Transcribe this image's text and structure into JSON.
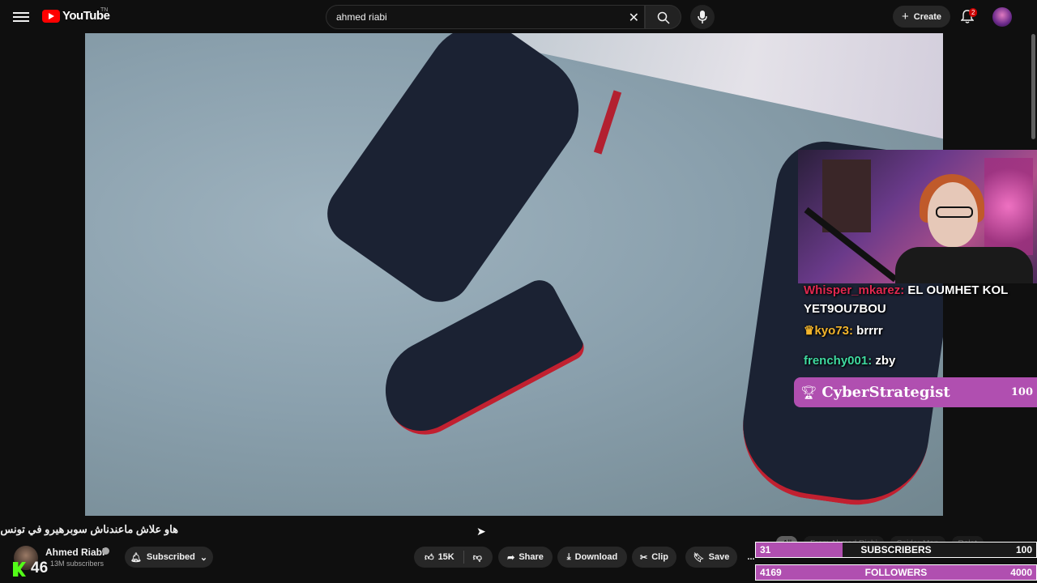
{
  "header": {
    "logo_text": "YouTube",
    "country_code": "TN",
    "search_value": "ahmed riabi",
    "create_label": "Create",
    "notification_count": "2"
  },
  "video": {
    "title": "هاو علاش ماعندناش سوبرهيرو في تونس"
  },
  "channel": {
    "name": "Ahmed Riabi",
    "subscribers": "13M subscribers",
    "subscribe_label": "Subscribed"
  },
  "actions": {
    "likes": "15K",
    "share": "Share",
    "download": "Download",
    "clip": "Clip",
    "save": "Save",
    "more": "..."
  },
  "chips": [
    "All",
    "From Ahmed Riabi",
    "Spider-Man",
    "Relat"
  ],
  "overlay": {
    "kick_viewers": "46",
    "chat": [
      {
        "user": "Whisper_mkarez:",
        "user_color": "#e0284f",
        "message": "EL OUMHET KOL YET9OU7BOU",
        "badge": ""
      },
      {
        "user": "kyo73:",
        "user_color": "#f3b52c",
        "message": "brrrr",
        "badge": "♛"
      },
      {
        "user": "frenchy001:",
        "user_color": "#3fd9a0",
        "message": "zby",
        "badge": ""
      }
    ],
    "alert": {
      "name": "CyberStrategist",
      "count": "100"
    },
    "subs_goal": {
      "current": "31",
      "label": "SUBSCRIBERS",
      "target": "100",
      "progress": 0.31
    },
    "followers_goal": {
      "current": "4169",
      "label": "FOLLOWERS",
      "target": "4000",
      "progress": 1.0
    }
  }
}
